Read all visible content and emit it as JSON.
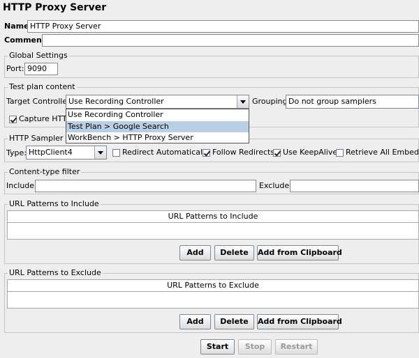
{
  "title": "HTTP Proxy Server",
  "name": {
    "label": "Name:",
    "value": "HTTP Proxy Server"
  },
  "comments": {
    "label": "Comments:",
    "value": ""
  },
  "global_settings": {
    "title": "Global Settings",
    "port_label": "Port:",
    "port_value": "9090"
  },
  "test_plan": {
    "title": "Test plan content",
    "target_label": "Target Controller:",
    "target_value": "Use Recording Controller",
    "grouping_label": "Grouping:",
    "grouping_value": "Do not group samplers",
    "capture_label": "Capture HTTP I",
    "dropdown_options": [
      "Use Recording Controller",
      "Test Plan > Google Search",
      "WorkBench > HTTP Proxy Server"
    ]
  },
  "sampler_settings": {
    "title": "HTTP Sampler set",
    "type_label": "Type:",
    "type_value": "HttpClient4",
    "redirect_auto": "Redirect Automatically",
    "follow_redirects": "Follow Redirects",
    "keepalive": "Use KeepAlive",
    "retrieve_embedded": "Retrieve All Embedded"
  },
  "content_filter": {
    "title": "Content-type filter",
    "include_label": "Include:",
    "exclude_label": "Exclude:"
  },
  "include_patterns": {
    "title": "URL Patterns to Include",
    "header": "URL Patterns to Include"
  },
  "exclude_patterns": {
    "title": "URL Patterns to Exclude",
    "header": "URL Patterns to Exclude"
  },
  "buttons": {
    "add": "Add",
    "delete": "Delete",
    "add_from_clipboard": "Add from Clipboard",
    "start": "Start",
    "stop": "Stop",
    "restart": "Restart"
  }
}
